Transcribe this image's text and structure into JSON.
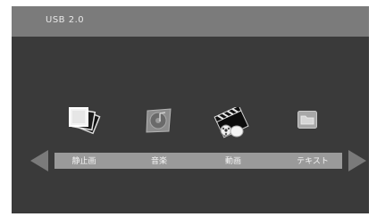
{
  "title_bar": {
    "text": "USB 2.0"
  },
  "media_menu": {
    "items": [
      {
        "label": "静止画",
        "icon": "photo-stack-icon"
      },
      {
        "label": "音楽",
        "icon": "music-disc-icon"
      },
      {
        "label": "動画",
        "icon": "movie-clapper-reel-icon"
      },
      {
        "label": "テキスト",
        "icon": "folder-icon"
      }
    ],
    "left_arrow": "left-arrow-icon",
    "right_arrow": "right-arrow-icon"
  },
  "colors": {
    "screen_bg": "#3a3a3a",
    "title_bar_bg": "#7b7b7b",
    "label_bar_bg": "#9a9a9a",
    "arrow": "#7a7a7a"
  }
}
